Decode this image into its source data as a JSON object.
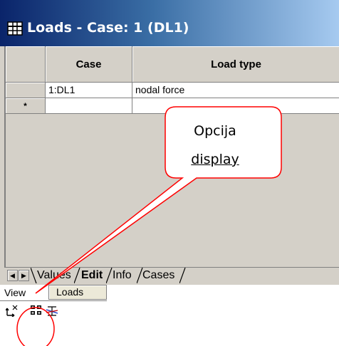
{
  "window": {
    "title": "Loads - Case: 1 (DL1)",
    "icon": "table-grid-icon"
  },
  "grid": {
    "columns": [
      "Case",
      "Load type"
    ],
    "rows": [
      {
        "handle": "",
        "case": "1:DL1",
        "load_type": "nodal force"
      },
      {
        "handle": "*",
        "case": "",
        "load_type": ""
      }
    ]
  },
  "tabs": {
    "items": [
      "Values",
      "Edit",
      "Info",
      "Cases"
    ],
    "active": "Edit",
    "scroll_icons": [
      "scroll-left-icon",
      "scroll-right-icon"
    ]
  },
  "bottom": {
    "view_label": "View",
    "loads_button": "Loads",
    "toolbar_icons": [
      "axis-swap-icon",
      "display-grid-icon",
      "scale-icon"
    ]
  },
  "annotation": {
    "line1": "Opcija",
    "line2": "display",
    "bubble_border_color": "#ff0000",
    "circle_color": "#ff0000"
  },
  "colors": {
    "title_start": "#0a246a",
    "title_end": "#a6caf0",
    "window_bg": "#d4d0c8"
  }
}
